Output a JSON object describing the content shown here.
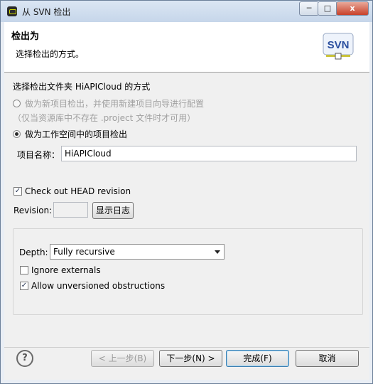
{
  "window": {
    "title": "从 SVN 检出",
    "min_label": "─",
    "max_label": "□",
    "close_label": "x"
  },
  "banner": {
    "title": "检出为",
    "message": "选择检出的方式。",
    "logo_text": "SVN"
  },
  "method": {
    "section_title": "选择检出文件夹 HiAPICloud 的方式",
    "option_new_project": "做为新项目检出，并使用新建项目向导进行配置",
    "option_new_project_hint": "（仅当资源库中不存在 .project 文件时才可用）",
    "option_workspace": "做为工作空间中的项目检出",
    "selected": "option_workspace"
  },
  "project": {
    "label": "项目名称：",
    "value": "HiAPICloud"
  },
  "revision": {
    "head_checkbox_label": "Check out HEAD revision",
    "head_checked": true,
    "revision_label": "Revision:",
    "revision_value": "",
    "show_log_label": "显示日志"
  },
  "options": {
    "depth_label": "Depth:",
    "depth_value": "Fully recursive",
    "ignore_externals_label": "Ignore externals",
    "ignore_externals_checked": false,
    "allow_unversioned_label": "Allow unversioned obstructions",
    "allow_unversioned_checked": true
  },
  "footer": {
    "help_label": "?",
    "back_label": "< 上一步(B)",
    "next_label": "下一步(N) >",
    "finish_label": "完成(F)",
    "cancel_label": "取消"
  },
  "colors": {
    "accent": "#3c7fb1",
    "svn_logo": "#2b4f9f"
  }
}
